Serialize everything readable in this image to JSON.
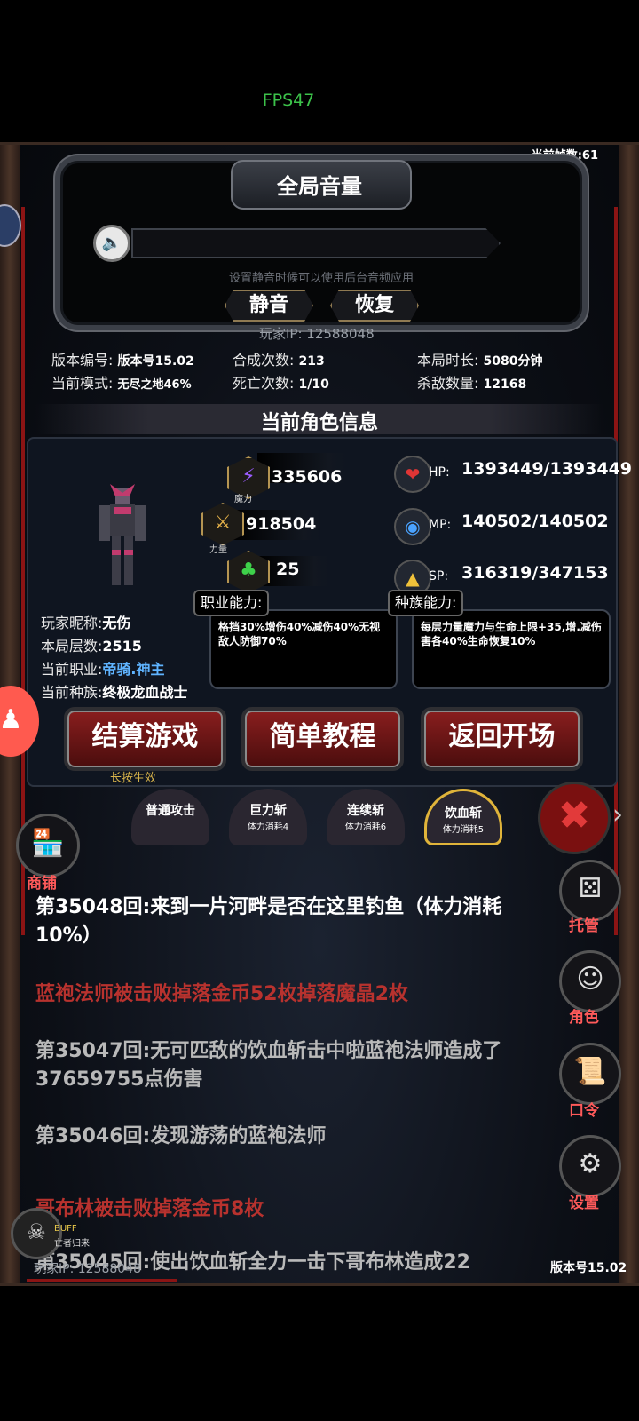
{
  "status_bar": {
    "fps": "FPS47"
  },
  "header": {
    "frame_count": "当前帧数:61"
  },
  "volume": {
    "title": "全局音量",
    "hint": "设置静音时候可以使用后台音频应用",
    "mute_label": "静音",
    "restore_label": "恢复",
    "player_ip": "玩家IP:  12588048"
  },
  "stats": {
    "version_k": "版本编号:",
    "version_v": "版本号15.02",
    "mode_k": "当前模式:",
    "mode_v": "无尽之地46%",
    "synth_k": "合成次数:",
    "synth_v": "213",
    "death_k": "死亡次数:",
    "death_v": "1/10",
    "time_k": "本局时长:",
    "time_v": "5080分钟",
    "kills_k": "杀敌数量:",
    "kills_v": "12168"
  },
  "character": {
    "section_title": "当前角色信息",
    "magic_value": "335606",
    "magic_label": "魔力",
    "power_value": "918504",
    "power_label": "力量",
    "luck_value": "25",
    "luck_label": "幸运",
    "hp_label": "HP:",
    "hp_value": "1393449/1393449",
    "mp_label": "MP:",
    "mp_value": "140502/140502",
    "sp_label": "SP:",
    "sp_value": "316319/347153",
    "nickname_k": "玩家昵称:",
    "nickname_v": "无伤",
    "floor_k": "本局层数:",
    "floor_v": "2515",
    "class_k": "当前职业:",
    "class_v": "帝骑.神主",
    "race_k": "当前种族:",
    "race_v": "终极龙血战士",
    "job_ability_title": "职业能力:",
    "job_ability_text": "格挡30%增伤40%减伤40%无视敌人防御70%",
    "race_ability_title": "种族能力:",
    "race_ability_text": "每层力量魔力与生命上限+35,增.减伤害各40%生命恢复10%"
  },
  "actions": {
    "settle": "结算游戏",
    "settle_sub": "长按生效",
    "tutorial": "简单教程",
    "return": "返回开场"
  },
  "skills": [
    {
      "name": "普通攻击",
      "cost": ""
    },
    {
      "name": "巨力斩",
      "cost": "体力消耗4"
    },
    {
      "name": "连续斩",
      "cost": "体力消耗6"
    },
    {
      "name": "饮血斩",
      "cost": "体力消耗5"
    }
  ],
  "side_menu": {
    "shop": "商铺",
    "auto": "托管",
    "role": "角色",
    "code": "口令",
    "settings": "设置"
  },
  "buff": {
    "title": "BUFF",
    "sub": "亡者归来"
  },
  "log": [
    {
      "text": "第35048回:来到一片河畔是否在这里钓鱼（体力消耗10%）",
      "color": "#ffffff"
    },
    {
      "text": "蓝袍法师被击败掉落金币52枚掉落魔晶2枚",
      "color": "#b8322e"
    },
    {
      "text": "第35047回:无可匹敌的饮血斩击中啦蓝袍法师造成了37659755点伤害",
      "color": "#b9b9b9"
    },
    {
      "text": "第35046回:发现游荡的蓝袍法师",
      "color": "#b9b9b9"
    },
    {
      "text": "哥布林被击败掉落金币8枚",
      "color": "#b8322e"
    },
    {
      "text": "第35045回:使出饮血斩全力一击下哥布林造成22",
      "color": "#b9b9b9"
    }
  ],
  "footer": {
    "ip": "玩家IP:  12588048",
    "version": "版本号15.02"
  },
  "colors": {
    "accent_red": "#8a1e1e",
    "gold": "#b59552",
    "frame": "#3b3f47"
  }
}
